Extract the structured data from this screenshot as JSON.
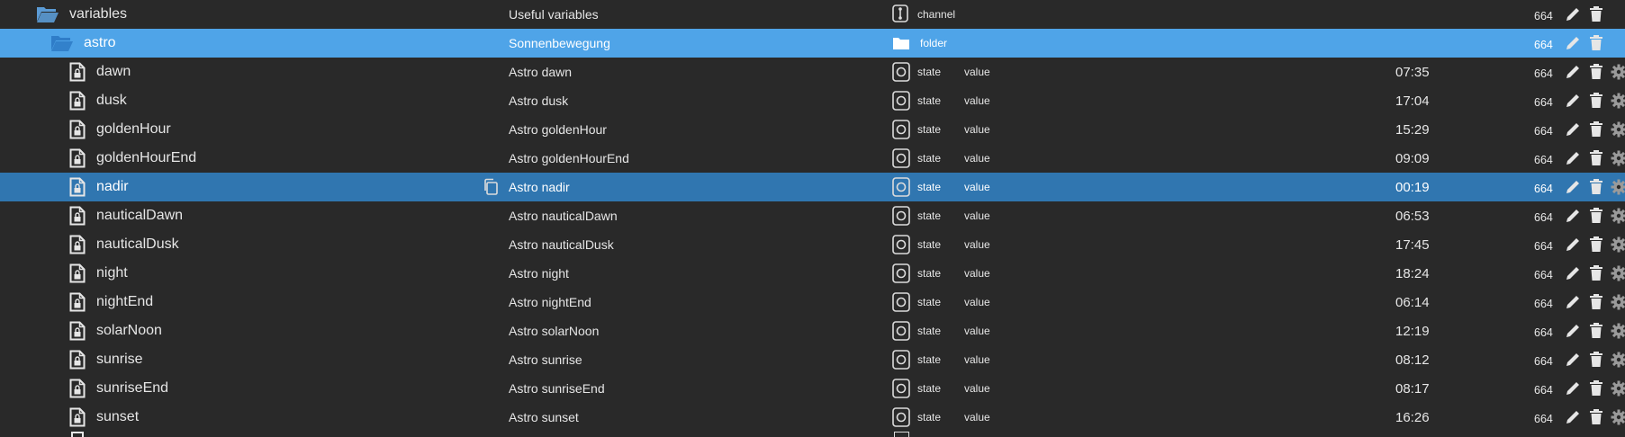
{
  "rows": [
    {
      "kind": "folder",
      "name": "variables",
      "desc": "Useful variables",
      "type": "channel",
      "role": "",
      "value": "",
      "acl": "664",
      "style": "normal"
    },
    {
      "kind": "folder",
      "name": "astro",
      "desc": "Sonnenbewegung",
      "type": "folder",
      "role": "",
      "value": "",
      "acl": "664",
      "style": "sel-light"
    },
    {
      "kind": "state",
      "name": "dawn",
      "desc": "Astro dawn",
      "type": "state",
      "role": "value",
      "value": "07:35",
      "acl": "664",
      "style": "normal"
    },
    {
      "kind": "state",
      "name": "dusk",
      "desc": "Astro dusk",
      "type": "state",
      "role": "value",
      "value": "17:04",
      "acl": "664",
      "style": "normal"
    },
    {
      "kind": "state",
      "name": "goldenHour",
      "desc": "Astro goldenHour",
      "type": "state",
      "role": "value",
      "value": "15:29",
      "acl": "664",
      "style": "normal"
    },
    {
      "kind": "state",
      "name": "goldenHourEnd",
      "desc": "Astro goldenHourEnd",
      "type": "state",
      "role": "value",
      "value": "09:09",
      "acl": "664",
      "style": "normal"
    },
    {
      "kind": "state",
      "name": "nadir",
      "desc": "Astro nadir",
      "type": "state",
      "role": "value",
      "value": "00:19",
      "acl": "664",
      "style": "sel-dark"
    },
    {
      "kind": "state",
      "name": "nauticalDawn",
      "desc": "Astro nauticalDawn",
      "type": "state",
      "role": "value",
      "value": "06:53",
      "acl": "664",
      "style": "normal"
    },
    {
      "kind": "state",
      "name": "nauticalDusk",
      "desc": "Astro nauticalDusk",
      "type": "state",
      "role": "value",
      "value": "17:45",
      "acl": "664",
      "style": "normal"
    },
    {
      "kind": "state",
      "name": "night",
      "desc": "Astro night",
      "type": "state",
      "role": "value",
      "value": "18:24",
      "acl": "664",
      "style": "normal"
    },
    {
      "kind": "state",
      "name": "nightEnd",
      "desc": "Astro nightEnd",
      "type": "state",
      "role": "value",
      "value": "06:14",
      "acl": "664",
      "style": "normal"
    },
    {
      "kind": "state",
      "name": "solarNoon",
      "desc": "Astro solarNoon",
      "type": "state",
      "role": "value",
      "value": "12:19",
      "acl": "664",
      "style": "normal"
    },
    {
      "kind": "state",
      "name": "sunrise",
      "desc": "Astro sunrise",
      "type": "state",
      "role": "value",
      "value": "08:12",
      "acl": "664",
      "style": "normal"
    },
    {
      "kind": "state",
      "name": "sunriseEnd",
      "desc": "Astro sunriseEnd",
      "type": "state",
      "role": "value",
      "value": "08:17",
      "acl": "664",
      "style": "normal"
    },
    {
      "kind": "state",
      "name": "sunset",
      "desc": "Astro sunset",
      "type": "state",
      "role": "value",
      "value": "16:26",
      "acl": "664",
      "style": "normal"
    }
  ],
  "icons": {
    "folder": "folder-open-icon",
    "state": "file-lock-icon",
    "edit": "pencil-icon",
    "delete": "trash-icon",
    "settings": "gear-icon",
    "copy": "copy-icon"
  },
  "colors": {
    "background": "#292929",
    "selected_folder": "#4fa4e8",
    "selected_row": "#3076b0",
    "folder_icon": "#5b9bd5",
    "text": "#e6e6e6"
  }
}
